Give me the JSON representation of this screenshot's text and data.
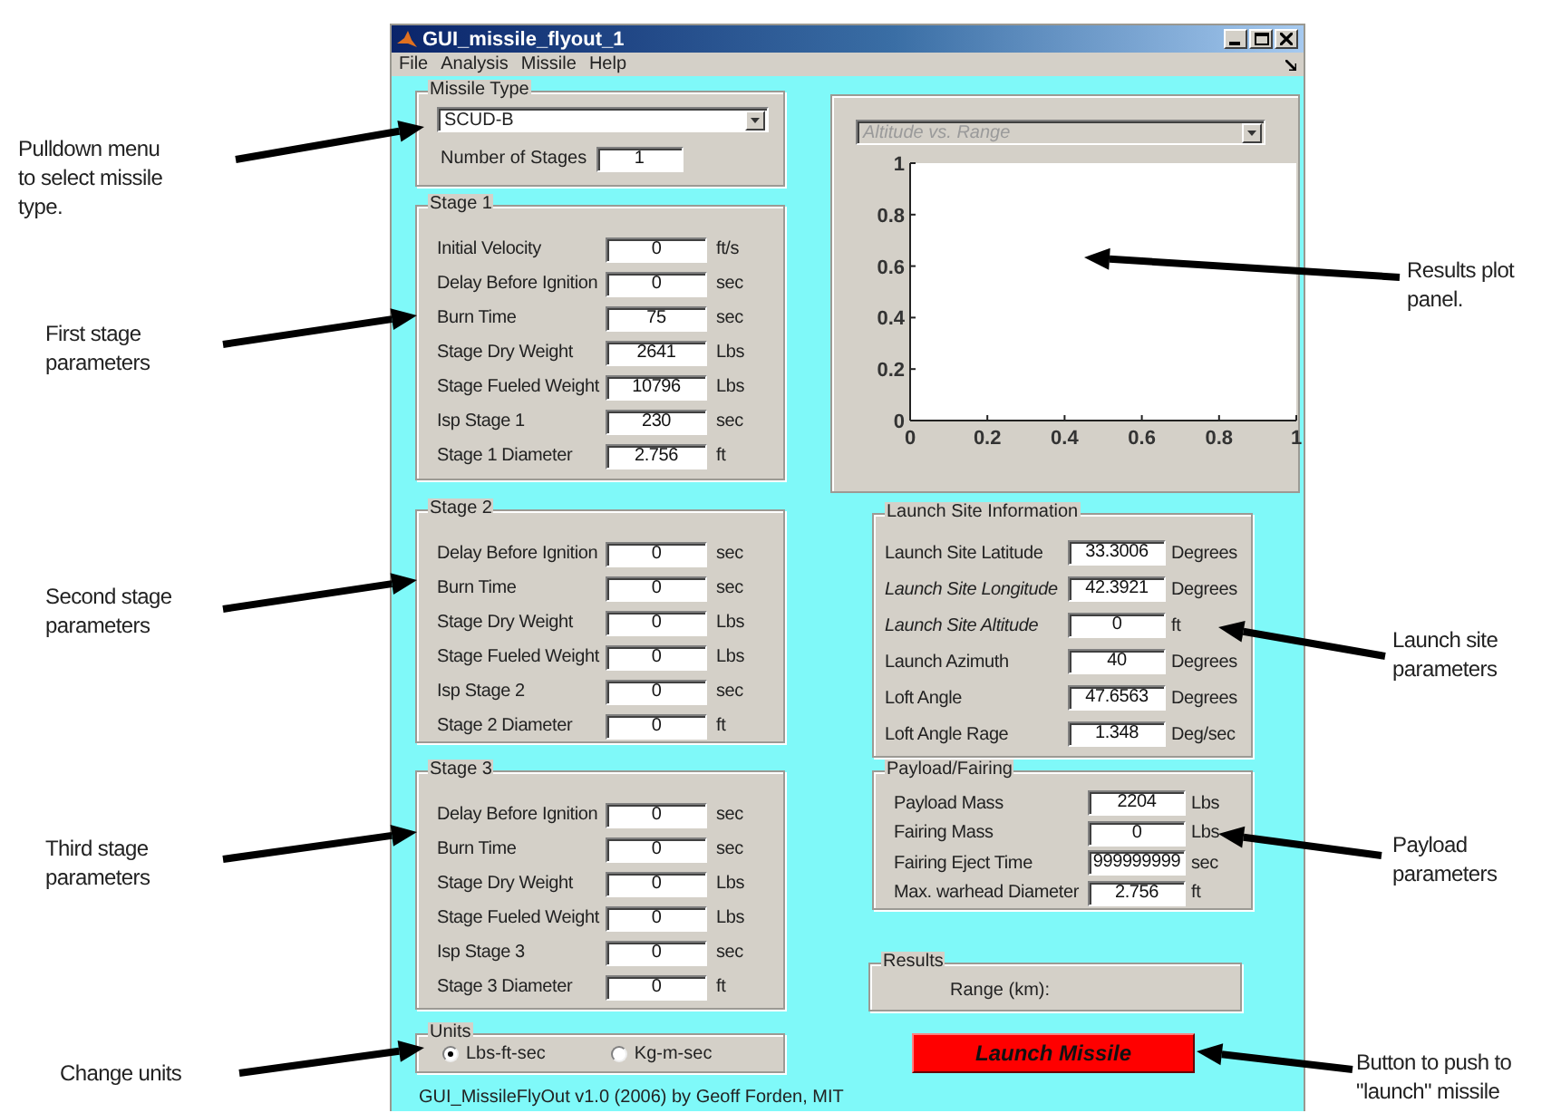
{
  "window": {
    "title": "GUI_missile_flyout_1",
    "menu": [
      "File",
      "Analysis",
      "Missile",
      "Help"
    ]
  },
  "missile_type": {
    "title": "Missile Type",
    "dropdown": "SCUD-B",
    "stages_label": "Number of Stages",
    "stages_value": "1"
  },
  "stages": [
    {
      "title": "Stage 1",
      "params": [
        {
          "label": "Initial Velocity",
          "value": "0",
          "unit": "ft/s"
        },
        {
          "label": "Delay Before Ignition",
          "value": "0",
          "unit": "sec"
        },
        {
          "label": "Burn Time",
          "value": "75",
          "unit": "sec"
        },
        {
          "label": "Stage Dry Weight",
          "value": "2641",
          "unit": "Lbs"
        },
        {
          "label": "Stage Fueled Weight",
          "value": "10796",
          "unit": "Lbs"
        },
        {
          "label": "Isp Stage 1",
          "value": "230",
          "unit": "sec"
        },
        {
          "label": "Stage 1 Diameter",
          "value": "2.756",
          "unit": "ft"
        }
      ]
    },
    {
      "title": "Stage 2",
      "params": [
        {
          "label": "Delay Before Ignition",
          "value": "0",
          "unit": "sec"
        },
        {
          "label": "Burn Time",
          "value": "0",
          "unit": "sec"
        },
        {
          "label": "Stage Dry Weight",
          "value": "0",
          "unit": "Lbs"
        },
        {
          "label": "Stage Fueled Weight",
          "value": "0",
          "unit": "Lbs"
        },
        {
          "label": "Isp Stage 2",
          "value": "0",
          "unit": "sec"
        },
        {
          "label": "Stage 2 Diameter",
          "value": "0",
          "unit": "ft"
        }
      ]
    },
    {
      "title": "Stage 3",
      "params": [
        {
          "label": "Delay Before Ignition",
          "value": "0",
          "unit": "sec"
        },
        {
          "label": "Burn Time",
          "value": "0",
          "unit": "sec"
        },
        {
          "label": "Stage Dry Weight",
          "value": "0",
          "unit": "Lbs"
        },
        {
          "label": "Stage Fueled Weight",
          "value": "0",
          "unit": "Lbs"
        },
        {
          "label": "Isp Stage 3",
          "value": "0",
          "unit": "sec"
        },
        {
          "label": "Stage 3 Diameter",
          "value": "0",
          "unit": "ft"
        }
      ]
    }
  ],
  "units": {
    "title": "Units",
    "options": [
      {
        "label": "Lbs-ft-sec",
        "selected": true
      },
      {
        "label": "Kg-m-sec",
        "selected": false
      }
    ]
  },
  "footer": "GUI_MissileFlyOut v1.0 (2006) by Geoff Forden, MIT",
  "plot": {
    "dropdown": "Altitude vs. Range",
    "disabled": true,
    "chart_data": {
      "type": "line",
      "xlim": [
        0,
        1
      ],
      "ylim": [
        0,
        1
      ],
      "xticks": [
        0,
        0.2,
        0.4,
        0.6,
        0.8,
        1
      ],
      "yticks": [
        0,
        0.2,
        0.4,
        0.6,
        0.8,
        1
      ]
    }
  },
  "launch_site": {
    "title": "Launch Site Information",
    "params": [
      {
        "label": "Launch Site Latitude",
        "value": "33.3006",
        "unit": "Degrees",
        "italic": false
      },
      {
        "label": "Launch Site Longitude",
        "value": "42.3921",
        "unit": "Degrees",
        "italic": true
      },
      {
        "label": "Launch Site Altitude",
        "value": "0",
        "unit": "ft",
        "italic": true
      },
      {
        "label": "Launch Azimuth",
        "value": "40",
        "unit": "Degrees",
        "italic": false
      },
      {
        "label": "Loft Angle",
        "value": "47.6563",
        "unit": "Degrees",
        "italic": false
      },
      {
        "label": "Loft Angle Rage",
        "value": "1.348",
        "unit": "Deg/sec",
        "italic": false
      }
    ]
  },
  "payload": {
    "title": "Payload/Fairing",
    "params": [
      {
        "label": "Payload Mass",
        "value": "2204",
        "unit": "Lbs"
      },
      {
        "label": "Fairing Mass",
        "value": "0",
        "unit": "Lbs"
      },
      {
        "label": "Fairing Eject Time",
        "value": "999999999",
        "unit": "sec"
      },
      {
        "label": "Max. warhead Diameter",
        "value": "2.756",
        "unit": "ft"
      }
    ]
  },
  "results": {
    "title": "Results",
    "label": "Range (km):"
  },
  "launch_button": "Launch Missile",
  "annotations": [
    {
      "lines": [
        "Pulldown menu",
        "to select missile",
        "type."
      ]
    },
    {
      "lines": [
        "First stage",
        "parameters"
      ]
    },
    {
      "lines": [
        "Second stage",
        "parameters"
      ]
    },
    {
      "lines": [
        "Third stage",
        "parameters"
      ]
    },
    {
      "lines": [
        "Change units"
      ]
    },
    {
      "lines": [
        "Results plot",
        "panel."
      ]
    },
    {
      "lines": [
        "Launch site",
        "parameters"
      ]
    },
    {
      "lines": [
        "Payload",
        "parameters"
      ]
    },
    {
      "lines": [
        "Button to push to",
        "\"launch\" missile"
      ]
    }
  ]
}
